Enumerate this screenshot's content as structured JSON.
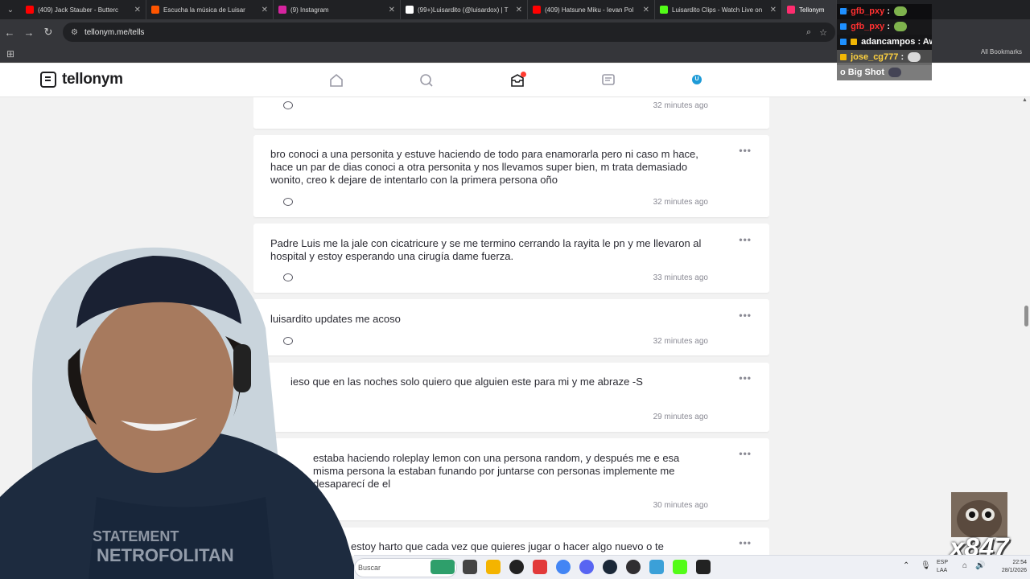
{
  "browser": {
    "tabs": [
      {
        "title": "(409) Jack Stauber - Butterc",
        "color": "#ff0000"
      },
      {
        "title": "Escucha la música de Luisar",
        "color": "#ff5500"
      },
      {
        "title": "(9) Instagram",
        "color": "#d6249f"
      },
      {
        "title": "(99+)Luisardito (@luisardox) | T",
        "color": "#ffffff"
      },
      {
        "title": "(409) Hatsune Miku - Ievan Pol",
        "color": "#ff0000"
      },
      {
        "title": "Luisardito Clips - Watch Live on",
        "color": "#53fc18"
      },
      {
        "title": "Tellonym",
        "color": "#ff2d6f"
      }
    ],
    "url": "tellonym.me/tells",
    "all_bookmarks": "All Bookmarks"
  },
  "site": {
    "logo": "tellonym",
    "nav_icons": [
      "home-icon",
      "search-icon",
      "inbox-icon",
      "feed-icon",
      "profile-icon"
    ],
    "avatar_initial": "U"
  },
  "tells": [
    {
      "text": "",
      "time": "32 minutes ago"
    },
    {
      "text": "bro conoci a una personita y estuve haciendo de todo para enamorarla pero ni caso m hace, hace un par de dias conoci a otra personita y nos llevamos super bien, m trata demasiado wonito, creo k dejare de intentarlo con la primera persona oño",
      "time": "32 minutes ago"
    },
    {
      "text": "Padre Luis me la jale con cicatricure y se me termino cerrando la rayita le pn y me llevaron al hospital y estoy esperando una cirugía dame fuerza.",
      "time": "33 minutes ago"
    },
    {
      "text": "luisardito updates me acoso",
      "time": "32 minutes ago"
    },
    {
      "text": "ieso que en las noches solo quiero que alguien este para mi y me abraze -S",
      "time": "29 minutes ago"
    },
    {
      "text": "estaba haciendo roleplay lemon con una persona random, y después me e esa misma persona la estaban funando por juntarse con personas implemente me desaparecí de el",
      "time": "30 minutes ago"
    },
    {
      "text": "estoy harto que cada vez que quieres jugar o hacer algo nuevo o te",
      "time": ""
    }
  ],
  "stream_chat": [
    {
      "user": "gfb_pxy",
      "msg": ":",
      "color": "#ff3030"
    },
    {
      "user": "gfb_pxy",
      "msg": ":",
      "color": "#ff3030"
    },
    {
      "user": "adancampos",
      "msg": ": Aw",
      "color": "#ffffff"
    },
    {
      "user": "jose_cg777",
      "msg": ":",
      "color": "#ffd23f"
    },
    {
      "user": "",
      "msg": "o Big Shot",
      "color": "#ffffff"
    }
  ],
  "watermark": "x847",
  "taskbar": {
    "search_placeholder": "Buscar",
    "language": "ESP LAA",
    "time": "22:54",
    "date": "28/1/2026"
  }
}
